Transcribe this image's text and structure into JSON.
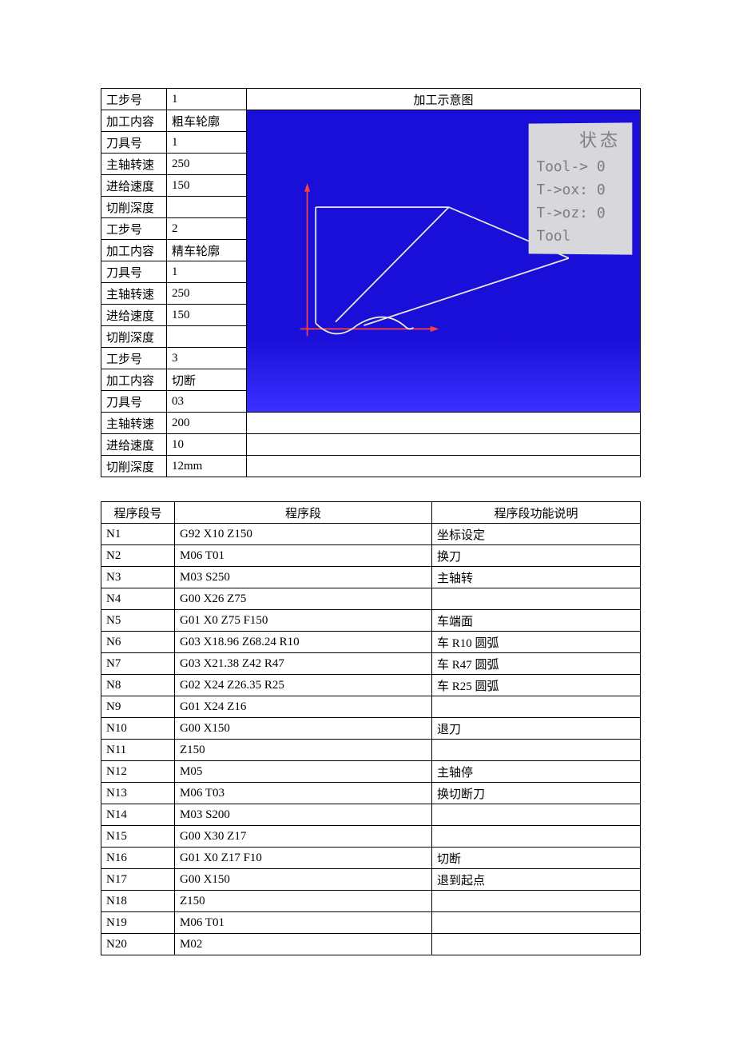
{
  "process_header": "加工示意图",
  "process_rows": [
    {
      "label": "工步号",
      "value": "1"
    },
    {
      "label": "加工内容",
      "value": "粗车轮廓"
    },
    {
      "label": "刀具号",
      "value": "1"
    },
    {
      "label": "主轴转速",
      "value": "250"
    },
    {
      "label": "进给速度",
      "value": "150"
    },
    {
      "label": "切削深度",
      "value": ""
    },
    {
      "label": "工步号",
      "value": "2"
    },
    {
      "label": "加工内容",
      "value": "精车轮廓"
    },
    {
      "label": "刀具号",
      "value": "1"
    },
    {
      "label": "主轴转速",
      "value": "250"
    },
    {
      "label": "进给速度",
      "value": "150"
    },
    {
      "label": "切削深度",
      "value": ""
    },
    {
      "label": "工步号",
      "value": "3"
    },
    {
      "label": "加工内容",
      "value": "切断"
    },
    {
      "label": "刀具号",
      "value": "03"
    },
    {
      "label": "主轴转速",
      "value": "200"
    },
    {
      "label": "进给速度",
      "value": "10"
    },
    {
      "label": "切削深度",
      "value": "12mm"
    }
  ],
  "status": {
    "title": "状态",
    "lines": [
      "Tool-> 0",
      "T->ox: 0",
      "T->oz: 0",
      "Tool"
    ]
  },
  "program_headers": [
    "程序段号",
    "程序段",
    "程序段功能说明"
  ],
  "program_rows": [
    {
      "n": "N1",
      "code": "G92 X10 Z150",
      "desc": "坐标设定"
    },
    {
      "n": "N2",
      "code": "M06 T01",
      "desc": "换刀"
    },
    {
      "n": "N3",
      "code": "M03 S250",
      "desc": "主轴转"
    },
    {
      "n": "N4",
      "code": "G00 X26 Z75",
      "desc": ""
    },
    {
      "n": "N5",
      "code": "G01 X0 Z75 F150",
      "desc": "车端面"
    },
    {
      "n": "N6",
      "code": "G03 X18.96 Z68.24 R10",
      "desc": "车 R10 圆弧"
    },
    {
      "n": "N7",
      "code": "G03 X21.38 Z42 R47",
      "desc": "车 R47 圆弧"
    },
    {
      "n": "N8",
      "code": "G02 X24 Z26.35 R25",
      "desc": "车 R25 圆弧"
    },
    {
      "n": "N9",
      "code": "G01 X24 Z16",
      "desc": ""
    },
    {
      "n": "N10",
      "code": "G00 X150",
      "desc": "退刀"
    },
    {
      "n": "N11",
      "code": "Z150",
      "desc": ""
    },
    {
      "n": "N12",
      "code": "M05",
      "desc": "主轴停"
    },
    {
      "n": "N13",
      "code": "M06 T03",
      "desc": "换切断刀"
    },
    {
      "n": "N14",
      "code": "M03 S200",
      "desc": ""
    },
    {
      "n": "N15",
      "code": "G00 X30 Z17",
      "desc": ""
    },
    {
      "n": "N16",
      "code": "G01 X0 Z17 F10",
      "desc": "切断"
    },
    {
      "n": "N17",
      "code": "G00 X150",
      "desc": "退到起点"
    },
    {
      "n": "N18",
      "code": "Z150",
      "desc": ""
    },
    {
      "n": "N19",
      "code": "M06 T01",
      "desc": ""
    },
    {
      "n": "N20",
      "code": "M02",
      "desc": ""
    }
  ]
}
